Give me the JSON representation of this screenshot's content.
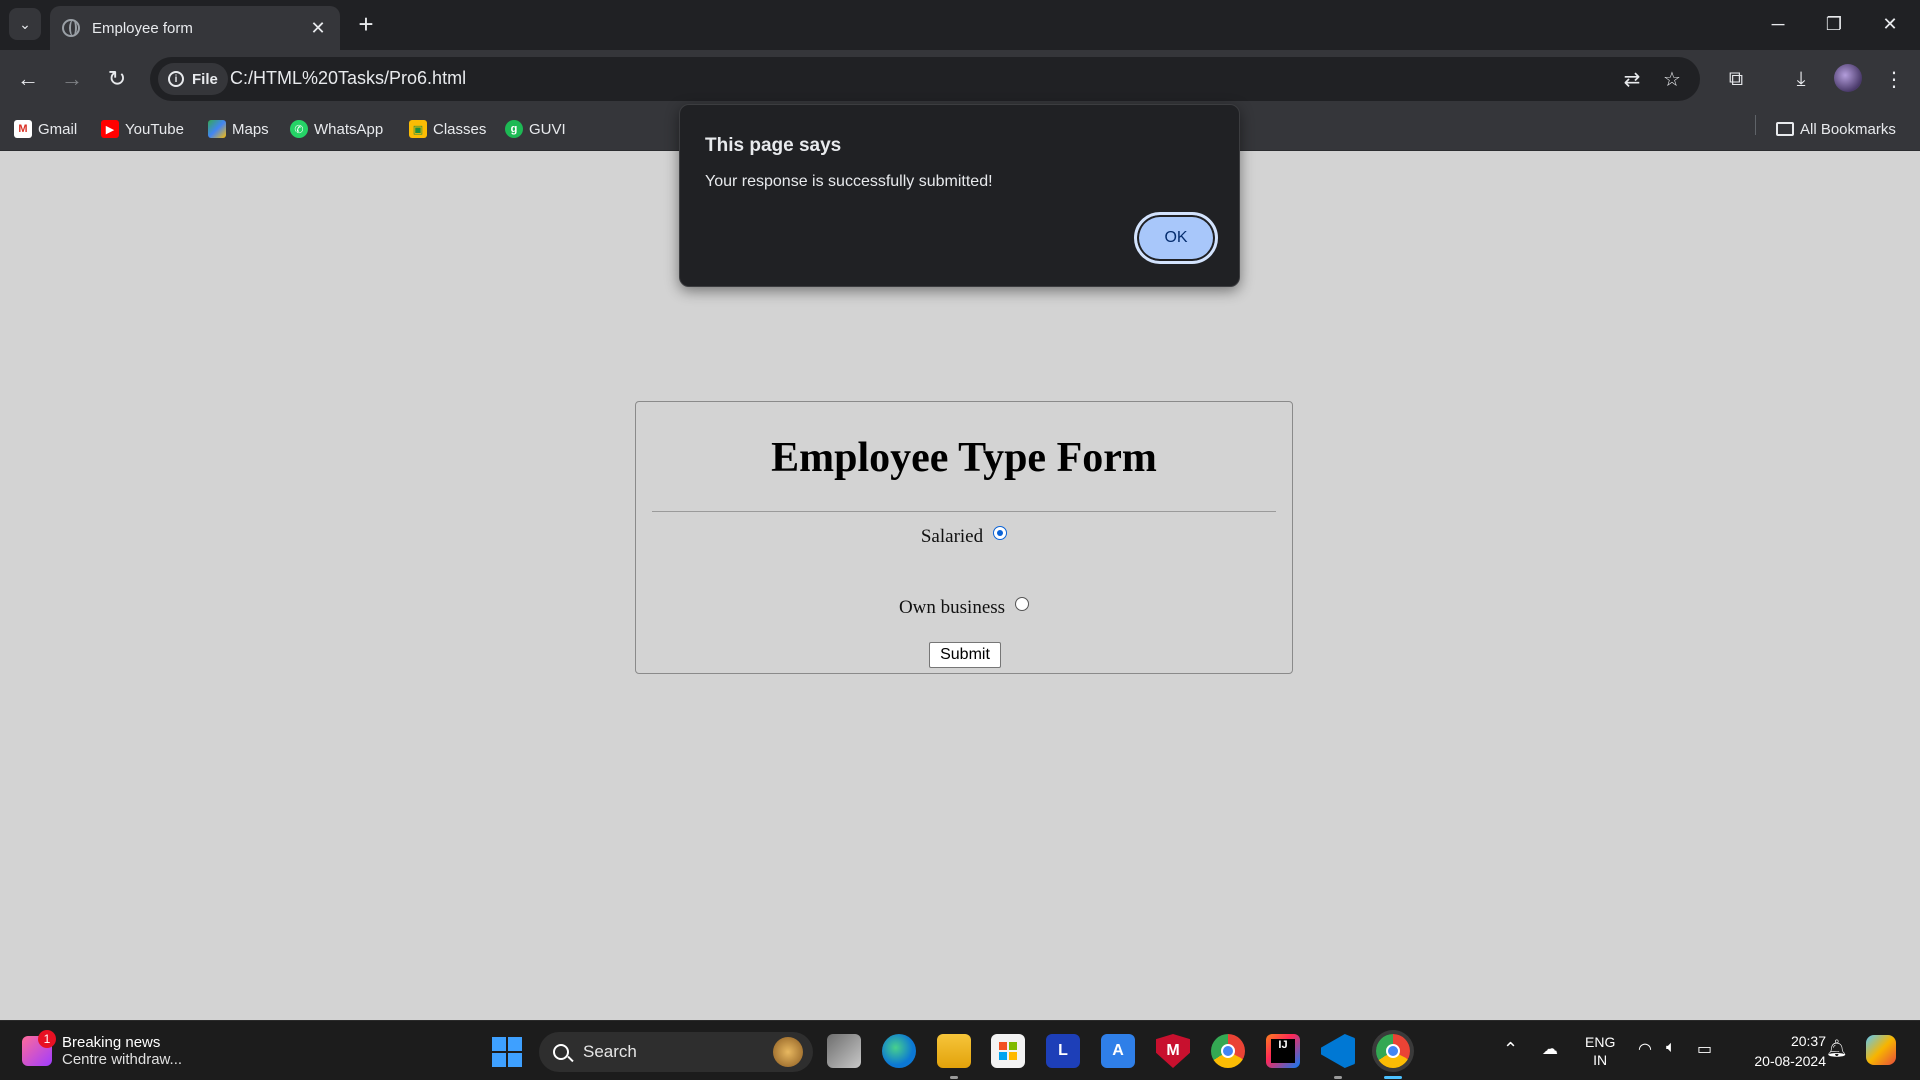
{
  "browser": {
    "tab_title": "Employee form",
    "new_tab_symbol": "+",
    "tab_close_symbol": "✕",
    "url_chip": "File",
    "url": "C:/HTML%20Tasks/Pro6.html",
    "bookmarks": [
      "Gmail",
      "YouTube",
      "Maps",
      "WhatsApp",
      "Classes",
      "GUVI"
    ],
    "all_bookmarks": "All Bookmarks"
  },
  "dialog": {
    "title": "This page says",
    "message": "Your response is successfully submitted!",
    "ok_label": "OK"
  },
  "form": {
    "title": "Employee Type Form",
    "options": [
      {
        "label": "Salaried",
        "checked": true
      },
      {
        "label": "Own business",
        "checked": false
      }
    ],
    "submit_label": "Submit"
  },
  "taskbar": {
    "news_badge": "1",
    "news_title": "Breaking news",
    "news_subtitle": "Centre withdraw...",
    "search_label": "Search",
    "language_top": "ENG",
    "language_bottom": "IN",
    "time": "20:37",
    "date": "20-08-2024",
    "pinned_apps": [
      "task-view",
      "edge",
      "file-explorer",
      "microsoft-store",
      "l-app",
      "a-app",
      "mcafee",
      "chrome",
      "intellij",
      "vscode",
      "chrome-profile"
    ]
  },
  "colors": {
    "page_background": "#d3d3d3",
    "chrome_dark": "#202124",
    "chrome_toolbar": "#35363a",
    "dialog_button": "#a8c7fa",
    "radio_accent": "#0b63d6"
  }
}
